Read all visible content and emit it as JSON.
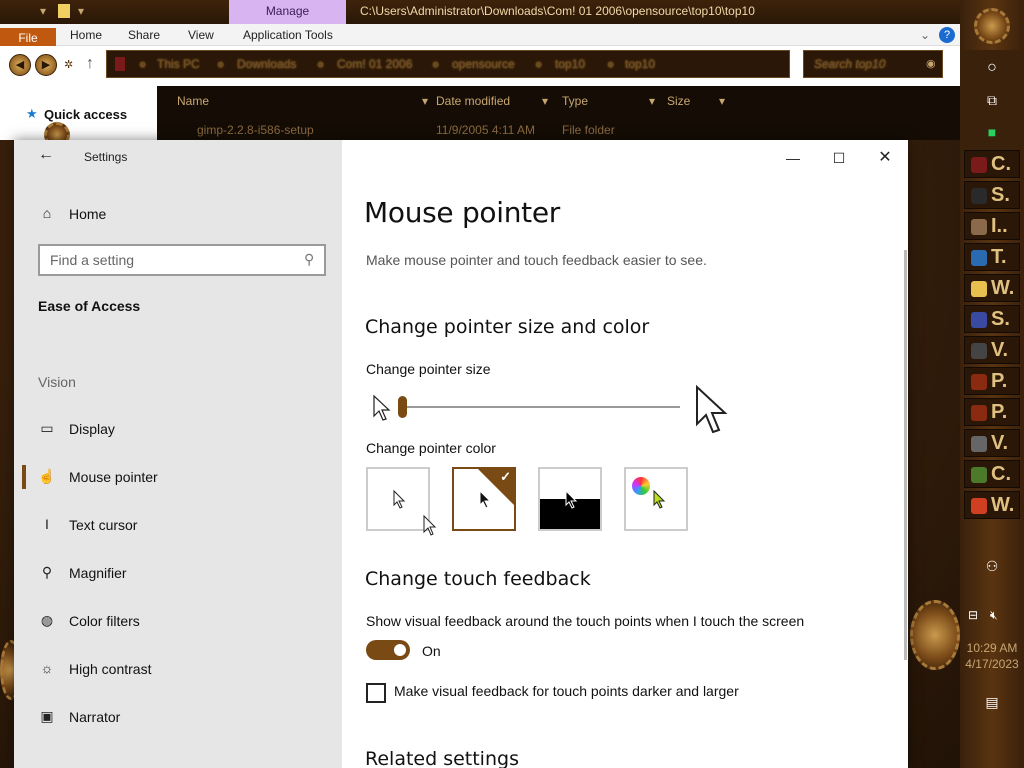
{
  "explorer": {
    "manage_tab": "Manage",
    "path": "C:\\Users\\Administrator\\Downloads\\Com! 01 2006\\opensource\\top10\\top10",
    "ribbon": [
      "File",
      "Home",
      "Share",
      "View",
      "Application Tools"
    ],
    "breadcrumbs": [
      "This PC",
      "Downloads",
      "Com! 01 2006",
      "opensource",
      "top10",
      "top10"
    ],
    "search_placeholder": "Search top10",
    "columns": [
      "Name",
      "Date modified",
      "Type",
      "Size"
    ],
    "row": {
      "name": "gimp-2.2.8-i586-setup",
      "date": "11/9/2005 4:11 AM",
      "type": "File folder"
    },
    "quick_access": "Quick access"
  },
  "taskbar": {
    "items": [
      {
        "letter": "C.",
        "color": "#7a1a1a"
      },
      {
        "letter": "S.",
        "color": "#2a2a2a"
      },
      {
        "letter": "I..",
        "color": "#8a6a4a"
      },
      {
        "letter": "T.",
        "color": "#2a6ab0"
      },
      {
        "letter": "W.",
        "color": "#e8c050"
      },
      {
        "letter": "S.",
        "color": "#3a4aa0"
      },
      {
        "letter": "V.",
        "color": "#444444"
      },
      {
        "letter": "P.",
        "color": "#8a2a10"
      },
      {
        "letter": "P.",
        "color": "#8a2a10"
      },
      {
        "letter": "V.",
        "color": "#666666"
      },
      {
        "letter": "C.",
        "color": "#4a7a2a"
      },
      {
        "letter": "W.",
        "color": "#d04020"
      }
    ],
    "time": "10:29 AM",
    "date": "4/17/2023"
  },
  "settings": {
    "title": "Settings",
    "home": "Home",
    "search_placeholder": "Find a setting",
    "category": "Ease of Access",
    "group": "Vision",
    "nav": [
      "Display",
      "Mouse pointer",
      "Text cursor",
      "Magnifier",
      "Color filters",
      "High contrast",
      "Narrator"
    ],
    "page_title": "Mouse pointer",
    "description": "Make mouse pointer and touch feedback easier to see.",
    "section1": "Change pointer size and color",
    "size_label": "Change pointer size",
    "size_value": 0.0,
    "color_label": "Change pointer color",
    "selected_color_index": 1,
    "section2": "Change touch feedback",
    "touch_label": "Show visual feedback around the touch points when I touch the screen",
    "toggle_state": "On",
    "checkbox_label": "Make visual feedback for touch points darker and larger",
    "section3": "Related settings",
    "accent": "#7a4a14"
  }
}
